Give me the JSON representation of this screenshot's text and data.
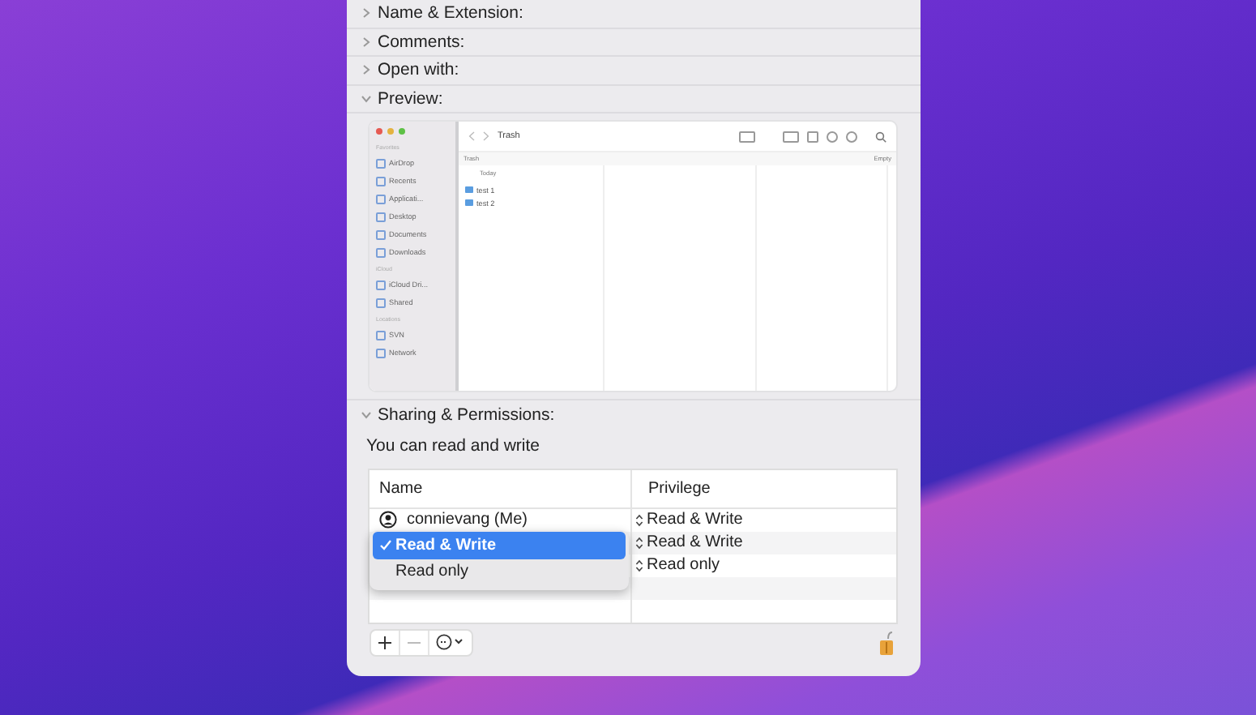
{
  "sections": [
    {
      "label": "Name & Extension:",
      "expanded": false
    },
    {
      "label": "Comments:",
      "expanded": false
    },
    {
      "label": "Open with:",
      "expanded": false
    },
    {
      "label": "Preview:",
      "expanded": true
    }
  ],
  "preview": {
    "title": "Trash",
    "path": "Trash",
    "path_action": "Empty",
    "column_heading": "Today",
    "sidebar": [
      {
        "heading": "Favorites",
        "items": [
          "AirDrop",
          "Recents",
          "Applicati...",
          "Desktop",
          "Documents",
          "Downloads"
        ]
      },
      {
        "heading": "iCloud",
        "items": [
          "iCloud Dri...",
          "Shared"
        ]
      },
      {
        "heading": "Locations",
        "items": [
          "SVN",
          "Network"
        ]
      }
    ],
    "files": [
      "test 1",
      "test 2"
    ]
  },
  "sharing": {
    "label": "Sharing & Permissions:",
    "expanded": true,
    "summary": "You can read and write",
    "columns": [
      "Name",
      "Privilege"
    ],
    "rows": [
      {
        "name": "connievang (Me)",
        "privilege": "Read & Write"
      },
      {
        "privilege": "Read & Write"
      },
      {
        "privilege": "Read only"
      }
    ],
    "menu": [
      {
        "label": "Read & Write",
        "selected": true
      },
      {
        "label": "Read only",
        "selected": false
      }
    ]
  }
}
